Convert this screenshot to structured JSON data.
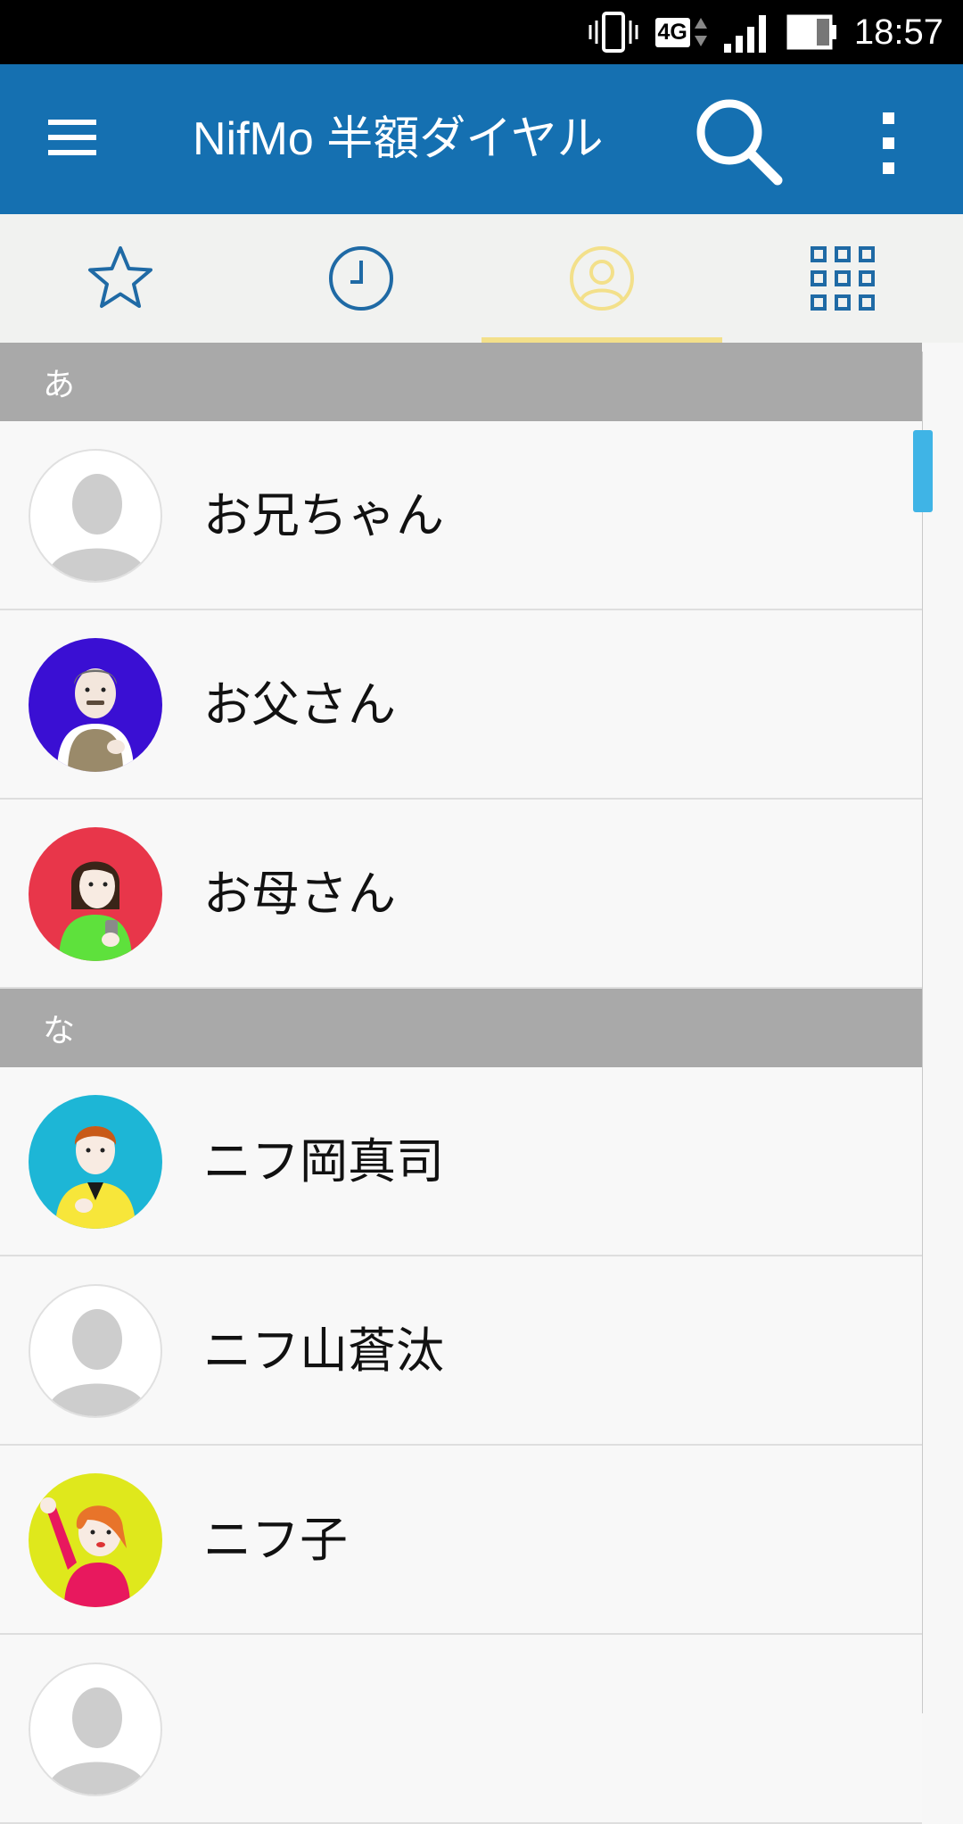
{
  "status_bar": {
    "network_label": "4G",
    "time": "18:57"
  },
  "app_bar": {
    "title": "NifMo 半額ダイヤル",
    "background_color": "#1570b1"
  },
  "tabs": [
    {
      "icon": "star-icon",
      "selected": false
    },
    {
      "icon": "clock-icon",
      "selected": false
    },
    {
      "icon": "person-icon",
      "selected": true
    },
    {
      "icon": "grid-icon",
      "selected": false
    }
  ],
  "accent": {
    "tab_icon_color": "#1f6aa5",
    "selected_tab_color": "#f3e08a"
  },
  "contacts": {
    "sections": [
      {
        "header": "あ",
        "items": [
          {
            "name": "お兄ちゃん",
            "avatar": "default-avatar-icon"
          },
          {
            "name": "お父さん",
            "avatar": "father-avatar"
          },
          {
            "name": "お母さん",
            "avatar": "mother-avatar"
          }
        ]
      },
      {
        "header": "な",
        "items": [
          {
            "name": "ニフ岡真司",
            "avatar": "boy-avatar"
          },
          {
            "name": "ニフ山蒼汰",
            "avatar": "default-avatar-icon"
          },
          {
            "name": "ニフ子",
            "avatar": "girl-avatar"
          }
        ]
      }
    ]
  }
}
